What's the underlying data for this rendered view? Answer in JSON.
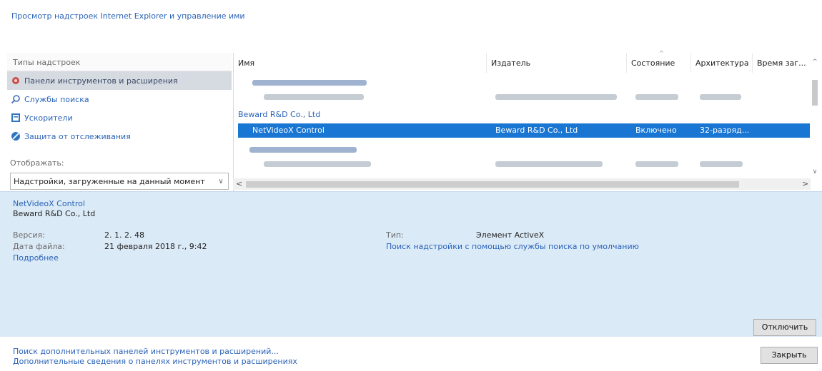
{
  "header": {
    "title": "Просмотр надстроек Internet Explorer и управление ими"
  },
  "types": {
    "header": "Типы надстроек",
    "items": [
      {
        "label": "Панели инструментов и расширения",
        "icon": "gear-icon"
      },
      {
        "label": "Службы поиска",
        "icon": "search-icon"
      },
      {
        "label": "Ускорители",
        "icon": "accelerator-icon"
      },
      {
        "label": "Защита от отслеживания",
        "icon": "no-tracking-icon"
      }
    ]
  },
  "show": {
    "label": "Отображать:",
    "value": "Надстройки, загруженные на данный момент"
  },
  "grid": {
    "columns": [
      "Имя",
      "Издатель",
      "Состояние",
      "Архитектура",
      "Время заг..."
    ],
    "group": "Beward R&D Co., Ltd",
    "selected_row": {
      "name": "NetVideoX Control",
      "publisher": "Beward R&D Co., Ltd",
      "state": "Включено",
      "arch": "32-разряд..."
    }
  },
  "details": {
    "name": "NetVideoX Control",
    "publisher": "Beward R&D Co., Ltd",
    "version_label": "Версия:",
    "version": "2. 1. 2. 48",
    "date_label": "Дата файла:",
    "date": "21 февраля 2018 г., 9:42",
    "more": "Подробнее",
    "type_label": "Тип:",
    "type": "Элемент ActiveX",
    "search_link": "Поиск надстройки с помощью службы поиска по умолчанию"
  },
  "buttons": {
    "disable": "Отключить",
    "close": "Закрыть"
  },
  "footer": {
    "link1": "Поиск дополнительных панелей инструментов и расширений...",
    "link2": "Дополнительные сведения о панелях инструментов и расширениях"
  },
  "colors": {
    "accent": "#1976d2",
    "link": "#2b63b8",
    "details_bg": "#dbeaf7"
  }
}
